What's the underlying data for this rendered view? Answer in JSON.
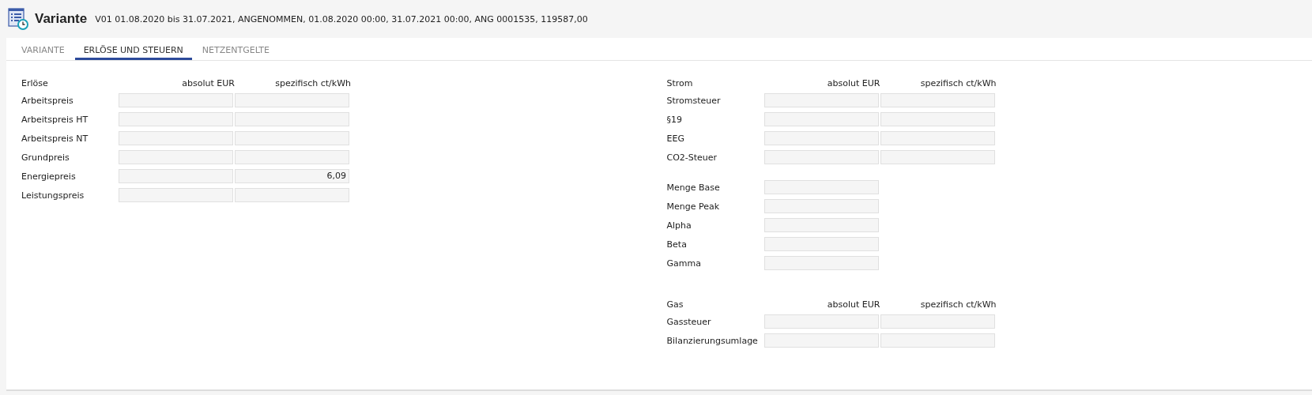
{
  "header": {
    "title": "Variante",
    "subtitle": "V01 01.08.2020 bis 31.07.2021, ANGENOMMEN, 01.08.2020 00:00, 31.07.2021 00:00, ANG 0001535, 119587,00"
  },
  "tabs": [
    {
      "label": "VARIANTE",
      "selected": false
    },
    {
      "label": "ERLÖSE UND STEUERN",
      "selected": true
    },
    {
      "label": "NETZENTGELTE",
      "selected": false
    }
  ],
  "left": {
    "groups": [
      {
        "title": "Erlöse",
        "columns": [
          "absolut EUR",
          "spezifisch ct/kWh"
        ],
        "rows": [
          {
            "label": "Arbeitspreis",
            "kind": "pair"
          },
          {
            "label": "Arbeitspreis HT",
            "kind": "pair"
          },
          {
            "label": "Arbeitspreis NT",
            "kind": "pair"
          },
          {
            "label": "Grundpreis",
            "kind": "pair"
          },
          {
            "label": "Energiepreis",
            "kind": "pair",
            "value_2": "6,09"
          },
          {
            "label": "Leistungspreis",
            "kind": "pair"
          }
        ]
      }
    ]
  },
  "right": {
    "groups": [
      {
        "title": "Strom",
        "columns": [
          "absolut EUR",
          "spezifisch ct/kWh"
        ],
        "rows": [
          {
            "label": "Stromsteuer",
            "kind": "pair"
          },
          {
            "label": "§19",
            "kind": "pair"
          },
          {
            "label": "EEG",
            "kind": "pair"
          },
          {
            "label": "CO2-Steuer",
            "kind": "pair"
          }
        ]
      },
      {
        "rows": [
          {
            "label": "Menge Base",
            "kind": "single"
          },
          {
            "label": "Menge Peak",
            "kind": "single"
          },
          {
            "label": "Alpha",
            "kind": "single"
          },
          {
            "label": "Beta",
            "kind": "single"
          },
          {
            "label": "Gamma",
            "kind": "single"
          }
        ]
      },
      {
        "title": "Gas",
        "columns": [
          "absolut EUR",
          "spezifisch ct/kWh"
        ],
        "rows": [
          {
            "label": "Gassteuer",
            "kind": "pair"
          },
          {
            "label": "Bilanzierungsumlage",
            "kind": "pair"
          }
        ]
      }
    ]
  }
}
